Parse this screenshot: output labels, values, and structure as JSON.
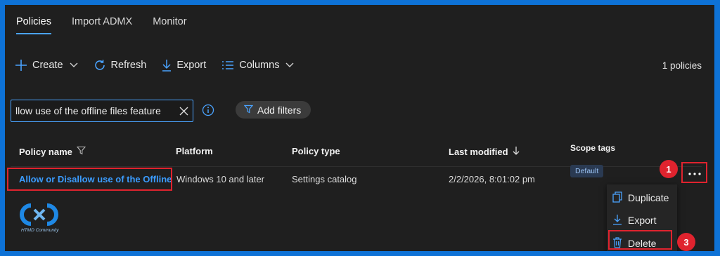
{
  "tabs": [
    {
      "label": "Policies",
      "active": true
    },
    {
      "label": "Import ADMX",
      "active": false
    },
    {
      "label": "Monitor",
      "active": false
    }
  ],
  "toolbar": {
    "create": "Create",
    "refresh": "Refresh",
    "export": "Export",
    "columns": "Columns",
    "count": "1 policies"
  },
  "search": {
    "value": "llow use of the offline files feature"
  },
  "filters": {
    "add_label": "Add filters"
  },
  "table": {
    "headers": {
      "name": "Policy name",
      "platform": "Platform",
      "type": "Policy type",
      "modified": "Last modified",
      "scope": "Scope tags"
    },
    "rows": [
      {
        "name": "Allow or Disallow use of the Offline",
        "platform": "Windows 10 and later",
        "type": "Settings catalog",
        "modified": "2/2/2026, 8:01:02 pm",
        "scope": "Default"
      }
    ]
  },
  "context_menu": {
    "duplicate": "Duplicate",
    "export": "Export",
    "delete": "Delete"
  },
  "callouts": {
    "step1": "1",
    "step3": "3"
  },
  "logo": {
    "text": "HTMD Community"
  },
  "colors": {
    "accent": "#4aa3ff",
    "link": "#3b9cff",
    "highlight": "#e0232e",
    "background": "#1f1f1f",
    "frame": "#0e72d6"
  }
}
